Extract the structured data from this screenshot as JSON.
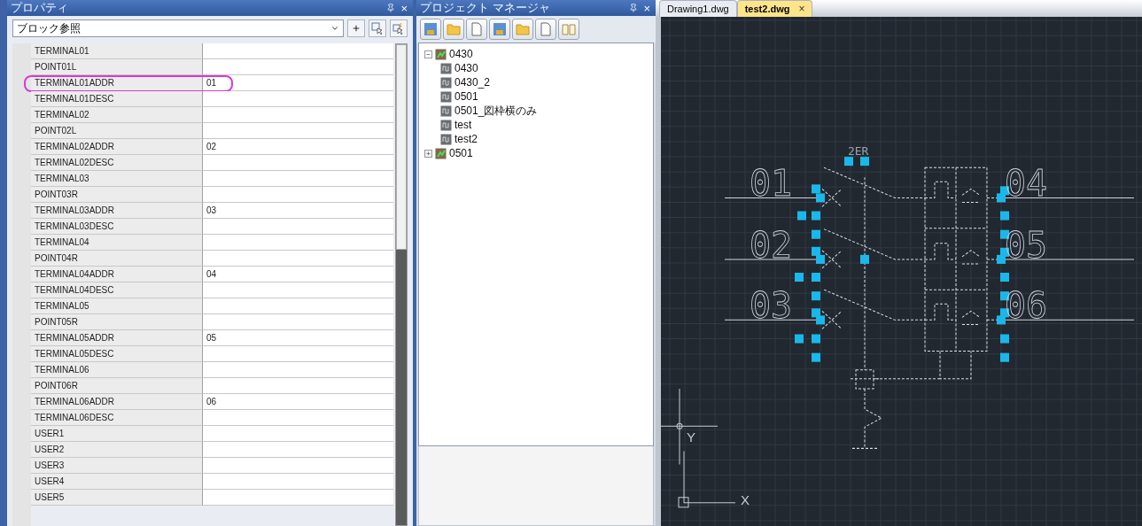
{
  "properties": {
    "title": "プロパティ",
    "close": "×",
    "selector": "ブロック参照",
    "rows": [
      {
        "name": "TERMINAL01",
        "value": "",
        "circled": false
      },
      {
        "name": "POINT01L",
        "value": "",
        "circled": false
      },
      {
        "name": "TERMINAL01ADDR",
        "value": "01",
        "circled": true
      },
      {
        "name": "TERMINAL01DESC",
        "value": "",
        "circled": false
      },
      {
        "name": "TERMINAL02",
        "value": "",
        "circled": false
      },
      {
        "name": "POINT02L",
        "value": "",
        "circled": false
      },
      {
        "name": "TERMINAL02ADDR",
        "value": "02",
        "circled": false
      },
      {
        "name": "TERMINAL02DESC",
        "value": "",
        "circled": false
      },
      {
        "name": "TERMINAL03",
        "value": "",
        "circled": false
      },
      {
        "name": "POINT03R",
        "value": "",
        "circled": false
      },
      {
        "name": "TERMINAL03ADDR",
        "value": "03",
        "circled": false
      },
      {
        "name": "TERMINAL03DESC",
        "value": "",
        "circled": false
      },
      {
        "name": "TERMINAL04",
        "value": "",
        "circled": false
      },
      {
        "name": "POINT04R",
        "value": "",
        "circled": false
      },
      {
        "name": "TERMINAL04ADDR",
        "value": "04",
        "circled": false
      },
      {
        "name": "TERMINAL04DESC",
        "value": "",
        "circled": false
      },
      {
        "name": "TERMINAL05",
        "value": "",
        "circled": false
      },
      {
        "name": "POINT05R",
        "value": "",
        "circled": false
      },
      {
        "name": "TERMINAL05ADDR",
        "value": "05",
        "circled": false
      },
      {
        "name": "TERMINAL05DESC",
        "value": "",
        "circled": false
      },
      {
        "name": "TERMINAL06",
        "value": "",
        "circled": false
      },
      {
        "name": "POINT06R",
        "value": "",
        "circled": false
      },
      {
        "name": "TERMINAL06ADDR",
        "value": "06",
        "circled": false
      },
      {
        "name": "TERMINAL06DESC",
        "value": "",
        "circled": false
      },
      {
        "name": "USER1",
        "value": "",
        "circled": false
      },
      {
        "name": "USER2",
        "value": "",
        "circled": false
      },
      {
        "name": "USER3",
        "value": "",
        "circled": false
      },
      {
        "name": "USER4",
        "value": "",
        "circled": false
      },
      {
        "name": "USER5",
        "value": "",
        "circled": false
      }
    ]
  },
  "project_manager": {
    "title": "プロジェクト マネージャ",
    "close": "×",
    "tree": [
      {
        "label": "0430",
        "expanded": true,
        "toggle": "−",
        "children": [
          {
            "label": "0430"
          },
          {
            "label": "0430_2"
          },
          {
            "label": "0501"
          },
          {
            "label": "0501_図枠横のみ"
          },
          {
            "label": "test"
          },
          {
            "label": "test2"
          }
        ]
      },
      {
        "label": "0501",
        "expanded": false,
        "toggle": "+"
      }
    ]
  },
  "drawing": {
    "tabs": [
      {
        "label": "Drawing1.dwg",
        "selected": false
      },
      {
        "label": "test2.dwg",
        "selected": true
      }
    ],
    "tab_close": "×",
    "tag": "2ER",
    "terminal_labels": [
      "01",
      "02",
      "03",
      "04",
      "05",
      "06"
    ],
    "axis_labels": {
      "x": "X",
      "y": "Y"
    }
  }
}
